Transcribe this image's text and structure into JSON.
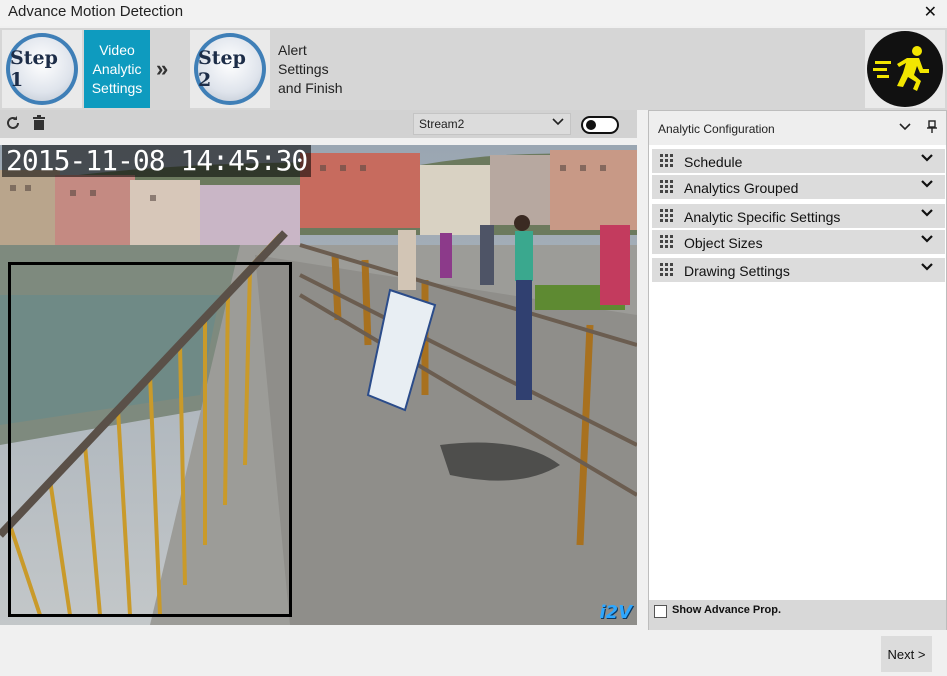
{
  "window": {
    "title": "Advance Motion Detection",
    "close_glyph": "✕"
  },
  "wizard": {
    "step1": {
      "badge": "Step 1",
      "label_lines": [
        "Video",
        "Analytic",
        "Settings"
      ],
      "active": true
    },
    "separator_glyph": "»",
    "step2": {
      "badge": "Step 2",
      "label_lines": [
        "Alert",
        "Settings",
        "and Finish"
      ],
      "active": false
    },
    "runner_icon": "running-man-icon"
  },
  "video_toolbar": {
    "refresh_icon": "refresh-icon",
    "delete_icon": "trash-icon",
    "stream_selected": "Stream2",
    "toggle_state": "off"
  },
  "video": {
    "timestamp": "2015-11-08  14:45:30",
    "watermark": "i2V"
  },
  "config": {
    "title": "Analytic Configuration",
    "sections": [
      "Schedule",
      "Analytics Grouped",
      "Analytic Specific Settings",
      "Object Sizes",
      "Drawing Settings"
    ],
    "show_advance_label": "Show Advance Prop.",
    "show_advance_checked": false
  },
  "footer": {
    "next_label": "Next >"
  },
  "colors": {
    "accent": "#0e9bbf",
    "badge_ring": "#3f7fb7",
    "runner_yellow": "#f2e600"
  }
}
